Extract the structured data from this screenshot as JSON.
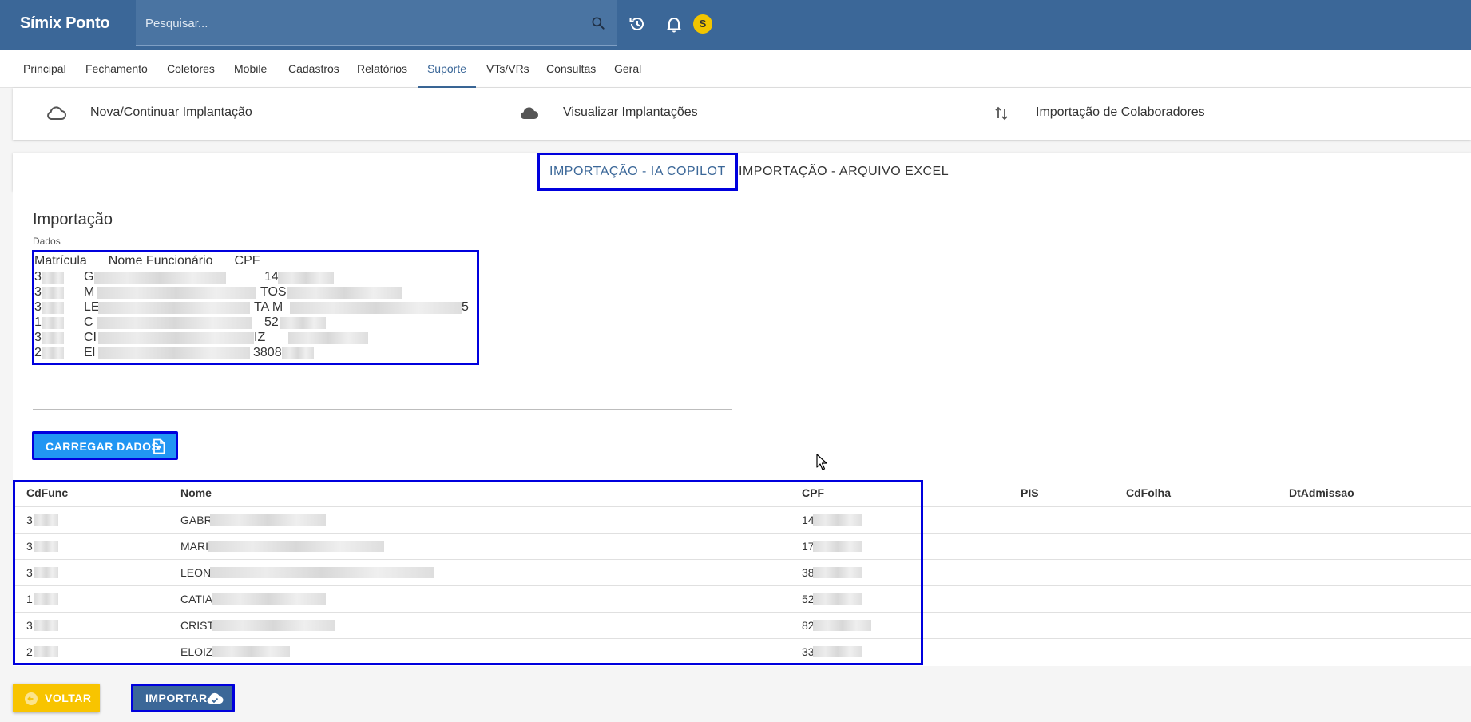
{
  "app": {
    "title": "Símix Ponto"
  },
  "search": {
    "placeholder": "Pesquisar..."
  },
  "topbar": {
    "avatar_letter": "S"
  },
  "nav": {
    "tabs": [
      "Principal",
      "Fechamento",
      "Coletores",
      "Mobile",
      "Cadastros",
      "Relatórios",
      "Suporte",
      "VTs/VRs",
      "Consultas",
      "Geral"
    ],
    "active": "Suporte"
  },
  "actions": [
    {
      "label": "Nova/Continuar Implantação",
      "icon": "cloud-outline-icon"
    },
    {
      "label": "Visualizar Implantações",
      "icon": "cloud-filled-icon"
    },
    {
      "label": "Importação de Colaboradores",
      "icon": "swap-vertical-icon"
    }
  ],
  "subtabs": [
    "IMPORTAÇÃO - IA COPILOT",
    "IMPORTAÇÃO - ARQUIVO EXCEL"
  ],
  "import": {
    "title": "Importação",
    "field_label": "Dados",
    "header": [
      "Matrícula",
      "Nome Funcionário",
      "CPF"
    ],
    "lines": [
      {
        "a": "3",
        "b": "G",
        "c": "14",
        "d": ""
      },
      {
        "a": "3",
        "b": "M",
        "c": "TOS",
        "d": ""
      },
      {
        "a": "3",
        "b": "LE",
        "c": "TA M",
        "d": "5"
      },
      {
        "a": "1",
        "b": "C",
        "c": "52",
        "d": ""
      },
      {
        "a": "3",
        "b": "CI",
        "c": "IZ",
        "d": ""
      },
      {
        "a": "2",
        "b": "El",
        "c": "3808",
        "d": ""
      }
    ],
    "load_button": "CARREGAR DADOS"
  },
  "table": {
    "columns": [
      "CdFunc",
      "Nome",
      "CPF",
      "PIS",
      "CdFolha",
      "DtAdmissao"
    ],
    "rows": [
      {
        "cdfunc": "3",
        "nome": "GABR",
        "cpf": "14"
      },
      {
        "cdfunc": "3",
        "nome": "MARI",
        "cpf": "17"
      },
      {
        "cdfunc": "3",
        "nome": "LEON",
        "cpf": "38"
      },
      {
        "cdfunc": "1",
        "nome": "CATIA",
        "cpf": "52"
      },
      {
        "cdfunc": "3",
        "nome": "CRIST",
        "cpf": "82"
      },
      {
        "cdfunc": "2",
        "nome": "ELOIZ",
        "cpf": "33"
      }
    ]
  },
  "footer": {
    "back_label": "VOLTAR",
    "import_label": "IMPORTAR"
  },
  "colors": {
    "primary": "#3b6798",
    "accent": "#2196f3",
    "warning": "#f8c400",
    "highlight": "#0000dd"
  }
}
